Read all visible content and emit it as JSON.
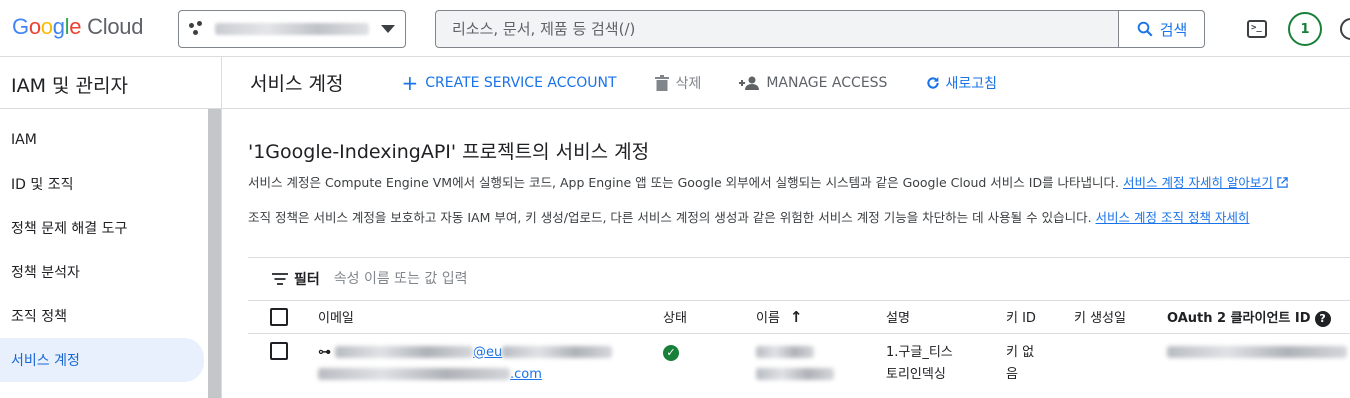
{
  "header": {
    "logo_google": [
      "G",
      "o",
      "o",
      "g",
      "l",
      "e"
    ],
    "logo_cloud": "Cloud",
    "search": {
      "placeholder": "리소스, 문서, 제품 등 검색(/)",
      "button_label": "검색"
    },
    "notification_count": "1"
  },
  "sidebar": {
    "title": "IAM 및 관리자",
    "items": [
      {
        "label": "IAM"
      },
      {
        "label": "ID 및 조직"
      },
      {
        "label": "정책 문제 해결 도구"
      },
      {
        "label": "정책 분석자"
      },
      {
        "label": "조직 정책"
      },
      {
        "label": "서비스 계정",
        "active": true
      }
    ]
  },
  "toolbar": {
    "page_title": "서비스 계정",
    "create_label": "CREATE SERVICE ACCOUNT",
    "delete_label": "삭제",
    "manage_access_label": "MANAGE ACCESS",
    "refresh_label": "새로고침"
  },
  "main": {
    "heading": "'1Google-IndexingAPI' 프로젝트의 서비스 계정",
    "desc1": "서비스 계정은 Compute Engine VM에서 실행되는 코드, App Engine 앱 또는 Google 외부에서 실행되는 시스템과 같은 Google Cloud 서비스 ID를 나타냅니다. ",
    "desc1_link": "서비스 계정 자세히 알아보기",
    "desc2": "조직 정책은 서비스 계정을 보호하고 자동 IAM 부여, 키 생성/업로드, 다른 서비스 계정의 생성과 같은 위험한 서비스 계정 기능을 차단하는 데 사용될 수 있습니다. ",
    "desc2_link": "서비스 계정 조직 정책 자세히",
    "filter_label": "필터",
    "filter_placeholder": "속성 이름 또는 값 입력"
  },
  "table": {
    "columns": {
      "email": "이메일",
      "status": "상태",
      "name": "이름",
      "description": "설명",
      "key_id": "키 ID",
      "key_created": "키 생성일",
      "oauth": "OAuth 2 클라이언트 ID"
    },
    "rows": [
      {
        "email_part1": "@eu",
        "email_part2": ".com",
        "description_line1": "1.구글_티스",
        "description_line2": "토리인덱싱",
        "key_id_line1": "키 없",
        "key_id_line2": "음"
      }
    ]
  },
  "colors": {
    "accent": "#1a73e8",
    "active_bg": "#e8f0fe",
    "status_ok": "#188038"
  }
}
